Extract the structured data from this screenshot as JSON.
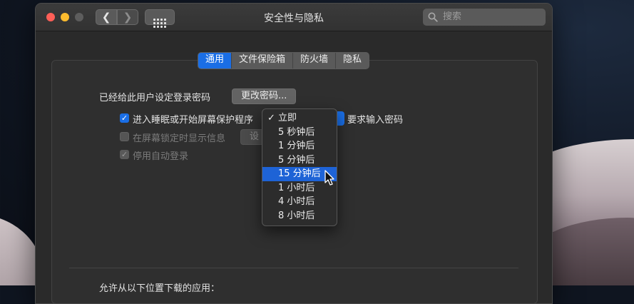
{
  "window": {
    "title": "安全性与隐私"
  },
  "toolbar": {
    "back_glyph": "❮",
    "forward_glyph": "❯",
    "show_all_icon": "grid-icon"
  },
  "search": {
    "placeholder": "搜索"
  },
  "tabs": [
    {
      "label": "通用",
      "active": true
    },
    {
      "label": "文件保险箱",
      "active": false
    },
    {
      "label": "防火墙",
      "active": false
    },
    {
      "label": "隐私",
      "active": false
    }
  ],
  "general": {
    "password_set_label": "已经给此用户设定登录密码",
    "change_password_button": "更改密码...",
    "require_password_label": "进入睡眠或开始屏幕保护程序",
    "require_password_suffix": "要求输入密码",
    "lock_message_label": "在屏幕锁定时显示信息",
    "lock_message_button": "设",
    "disable_auto_login_label": "停用自动登录",
    "download_apps_label": "允许从以下位置下载的应用："
  },
  "dropdown": {
    "checked_item": "立即",
    "selected_item": "15 分钟后",
    "items": [
      "立即",
      "5 秒钟后",
      "1 分钟后",
      "5 分钟后",
      "15 分钟后",
      "1 小时后",
      "4 小时后",
      "8 小时后"
    ]
  },
  "colors": {
    "accent": "#1a6ee5",
    "close": "#ff5f57",
    "minimize": "#febc2e"
  }
}
